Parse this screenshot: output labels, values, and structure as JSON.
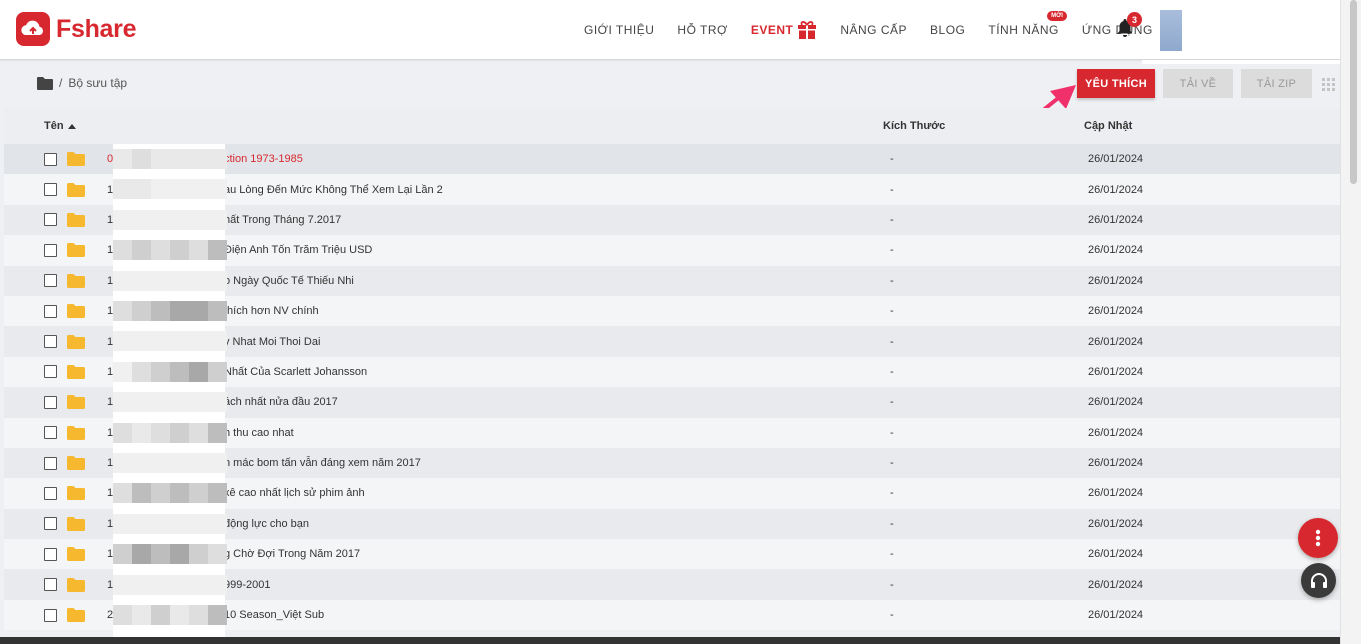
{
  "brand": {
    "name": "Fshare",
    "color": "#d8282f"
  },
  "nav": {
    "items": [
      {
        "label": "GIỚI THIỆU"
      },
      {
        "label": "HỖ TRỢ"
      },
      {
        "label": "EVENT"
      },
      {
        "label": "NÂNG CẤP"
      },
      {
        "label": "BLOG"
      },
      {
        "label": "TÍNH NĂNG",
        "badge": "MỚI"
      },
      {
        "label": "ỨNG DỤNG"
      }
    ],
    "notification_count": "3"
  },
  "breadcrumb": {
    "separator": "/",
    "current": "Bộ sưu tập"
  },
  "toolbar": {
    "favorite_label": "YÊU THÍCH",
    "download_label": "TẢI VỀ",
    "zip_label": "TẢI ZIP"
  },
  "table": {
    "columns": {
      "name": "Tên",
      "size": "Kích Thước",
      "updated": "Cập Nhật"
    },
    "rows": [
      {
        "num": "0",
        "name": "ction 1973-1985",
        "size": "-",
        "updated": "26/01/2024",
        "highlight": true
      },
      {
        "num": "1",
        "name": "au Lòng Đến Mức Không Thể Xem Lại Lần 2",
        "size": "-",
        "updated": "26/01/2024"
      },
      {
        "num": "1",
        "name": "hất Trong Tháng 7.2017",
        "size": "-",
        "updated": "26/01/2024"
      },
      {
        "num": "1",
        "name": "Điện Anh Tốn Trăm Triệu USD",
        "size": "-",
        "updated": "26/01/2024"
      },
      {
        "num": "1",
        "name": "o Ngày Quốc Tế Thiếu Nhi",
        "size": "-",
        "updated": "26/01/2024"
      },
      {
        "num": "1",
        "name": "thích hơn NV chính",
        "size": "-",
        "updated": "26/01/2024"
      },
      {
        "num": "1",
        "name": "y Nhat Moi Thoi Dai",
        "size": "-",
        "updated": "26/01/2024"
      },
      {
        "num": "1",
        "name": "Nhất Của Scarlett Johansson",
        "size": "-",
        "updated": "26/01/2024"
      },
      {
        "num": "1",
        "name": "ách nhất nửa đầu 2017",
        "size": "-",
        "updated": "26/01/2024"
      },
      {
        "num": "1",
        "name": "h thu cao nhat",
        "size": "-",
        "updated": "26/01/2024"
      },
      {
        "num": "1",
        "name": "n mác bom tấn vẫn đáng xem năm 2017",
        "size": "-",
        "updated": "26/01/2024"
      },
      {
        "num": "1",
        "name": "xê cao nhất lịch sử phim ảnh",
        "size": "-",
        "updated": "26/01/2024"
      },
      {
        "num": "1",
        "name": "động lực cho bạn",
        "size": "-",
        "updated": "26/01/2024"
      },
      {
        "num": "1",
        "name": "g Chờ Đợi Trong Năm 2017",
        "size": "-",
        "updated": "26/01/2024"
      },
      {
        "num": "1",
        "name": "999-2001",
        "size": "-",
        "updated": "26/01/2024"
      },
      {
        "num": "2",
        "name": "10 Season_Việt Sub",
        "size": "-",
        "updated": "26/01/2024"
      }
    ]
  }
}
